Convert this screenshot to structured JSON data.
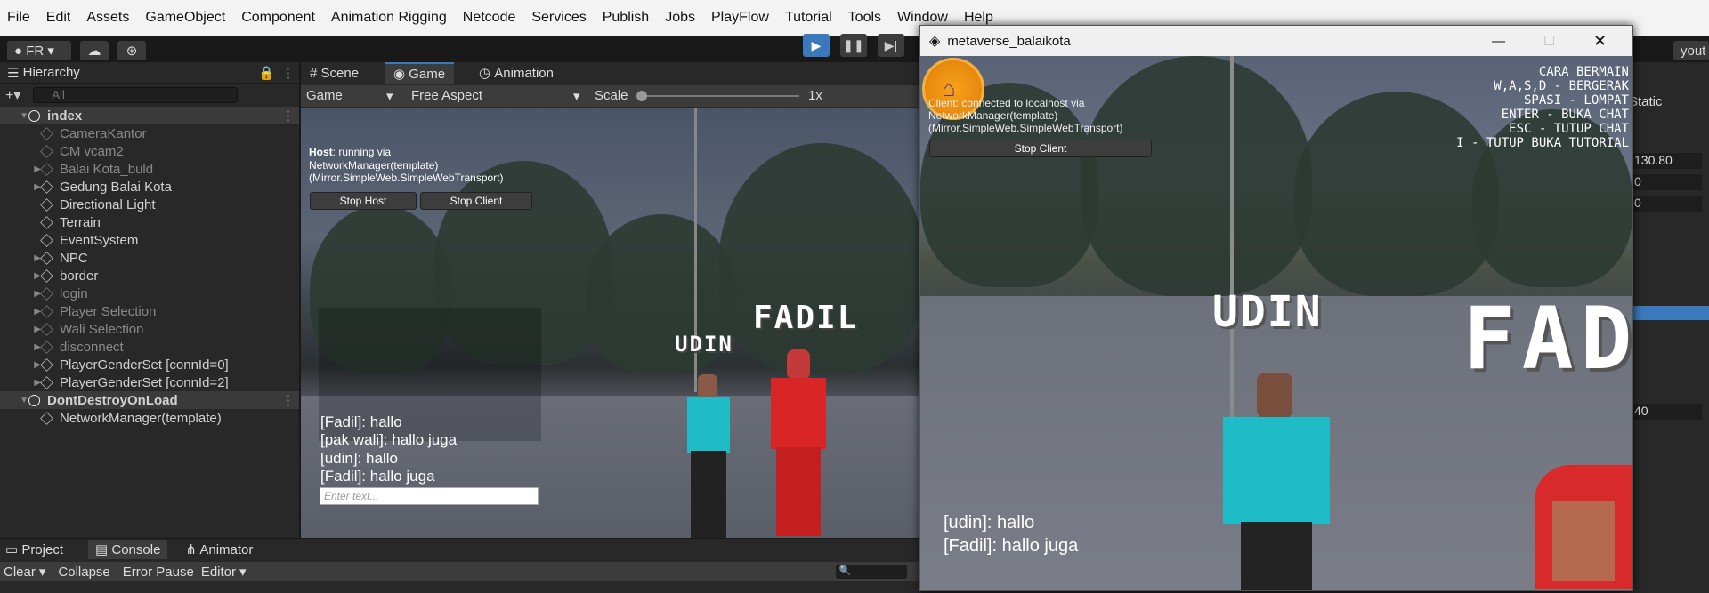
{
  "menu": [
    "File",
    "Edit",
    "Assets",
    "GameObject",
    "Component",
    "Animation Rigging",
    "Netcode",
    "Services",
    "Publish",
    "Jobs",
    "PlayFlow",
    "Tutorial",
    "Tools",
    "Window",
    "Help"
  ],
  "toolbar": {
    "account": "FR",
    "layout": "yout"
  },
  "hierarchy": {
    "title": "Hierarchy",
    "search_placeholder": "All",
    "items": [
      {
        "label": "index",
        "level": 0,
        "scene": true
      },
      {
        "label": "CameraKantor",
        "level": 1,
        "dim": true
      },
      {
        "label": "CM vcam2",
        "level": 1,
        "dim": true
      },
      {
        "label": "Balai Kota_buld",
        "level": 1,
        "dim": true,
        "fold": true
      },
      {
        "label": "Gedung Balai Kota",
        "level": 1,
        "fold": true
      },
      {
        "label": "Directional Light",
        "level": 1
      },
      {
        "label": "Terrain",
        "level": 1
      },
      {
        "label": "EventSystem",
        "level": 1
      },
      {
        "label": "NPC",
        "level": 1,
        "fold": true
      },
      {
        "label": "border",
        "level": 1,
        "fold": true
      },
      {
        "label": "login",
        "level": 1,
        "dim": true,
        "fold": true
      },
      {
        "label": "Player Selection",
        "level": 1,
        "dim": true,
        "fold": true
      },
      {
        "label": "Wali Selection",
        "level": 1,
        "dim": true,
        "fold": true
      },
      {
        "label": "disconnect",
        "level": 1,
        "dim": true,
        "fold": true
      },
      {
        "label": "PlayerGenderSet [connId=0]",
        "level": 1,
        "fold": true
      },
      {
        "label": "PlayerGenderSet [connId=2]",
        "level": 1,
        "fold": true
      },
      {
        "label": "DontDestroyOnLoad",
        "level": 0,
        "scene": true
      },
      {
        "label": "NetworkManager(template)",
        "level": 1
      }
    ]
  },
  "gameview": {
    "tabs": [
      "Scene",
      "Game",
      "Animation"
    ],
    "display": "Game",
    "aspect": "Free Aspect",
    "scale_label": "Scale",
    "scale_value": "1x",
    "host_status_bold": "Host",
    "host_status": ": running via",
    "host_status2": "NetworkManager(template)",
    "host_status3": "(Mirror.SimpleWeb.SimpleWebTransport)",
    "stop_host": "Stop Host",
    "stop_client": "Stop Client",
    "chat": [
      "[Fadil]: hallo",
      "[pak wali]: hallo juga",
      "[udin]: hallo",
      "[Fadil]: hallo juga"
    ],
    "chat_placeholder": "Enter text...",
    "names": [
      "UDIN",
      "FADIL"
    ]
  },
  "console": {
    "tabs": [
      "Project",
      "Console",
      "Animator"
    ],
    "buttons": [
      "Clear",
      "Collapse",
      "Error Pause",
      "Editor"
    ]
  },
  "right_panel": {
    "static": "Static",
    "values": [
      "130.80",
      "0",
      "0",
      "40"
    ]
  },
  "game_window": {
    "title": "metaverse_balaikota",
    "client_status": "Client: connected to localhost via",
    "client_status2": "NetworkManager(template)",
    "client_status3": "(Mirror.SimpleWeb.SimpleWebTransport)",
    "stop_client": "Stop Client",
    "hud": [
      "CARA BERMAIN",
      "W,A,S,D - BERGERAK",
      "SPASI - LOMPAT",
      "ENTER - BUKA CHAT",
      "ESC - TUTUP CHAT",
      "I - TUTUP BUKA TUTORIAL"
    ],
    "chat": [
      "[udin]: hallo",
      "[Fadil]: hallo juga"
    ],
    "names": [
      "UDIN",
      "FAD"
    ]
  }
}
